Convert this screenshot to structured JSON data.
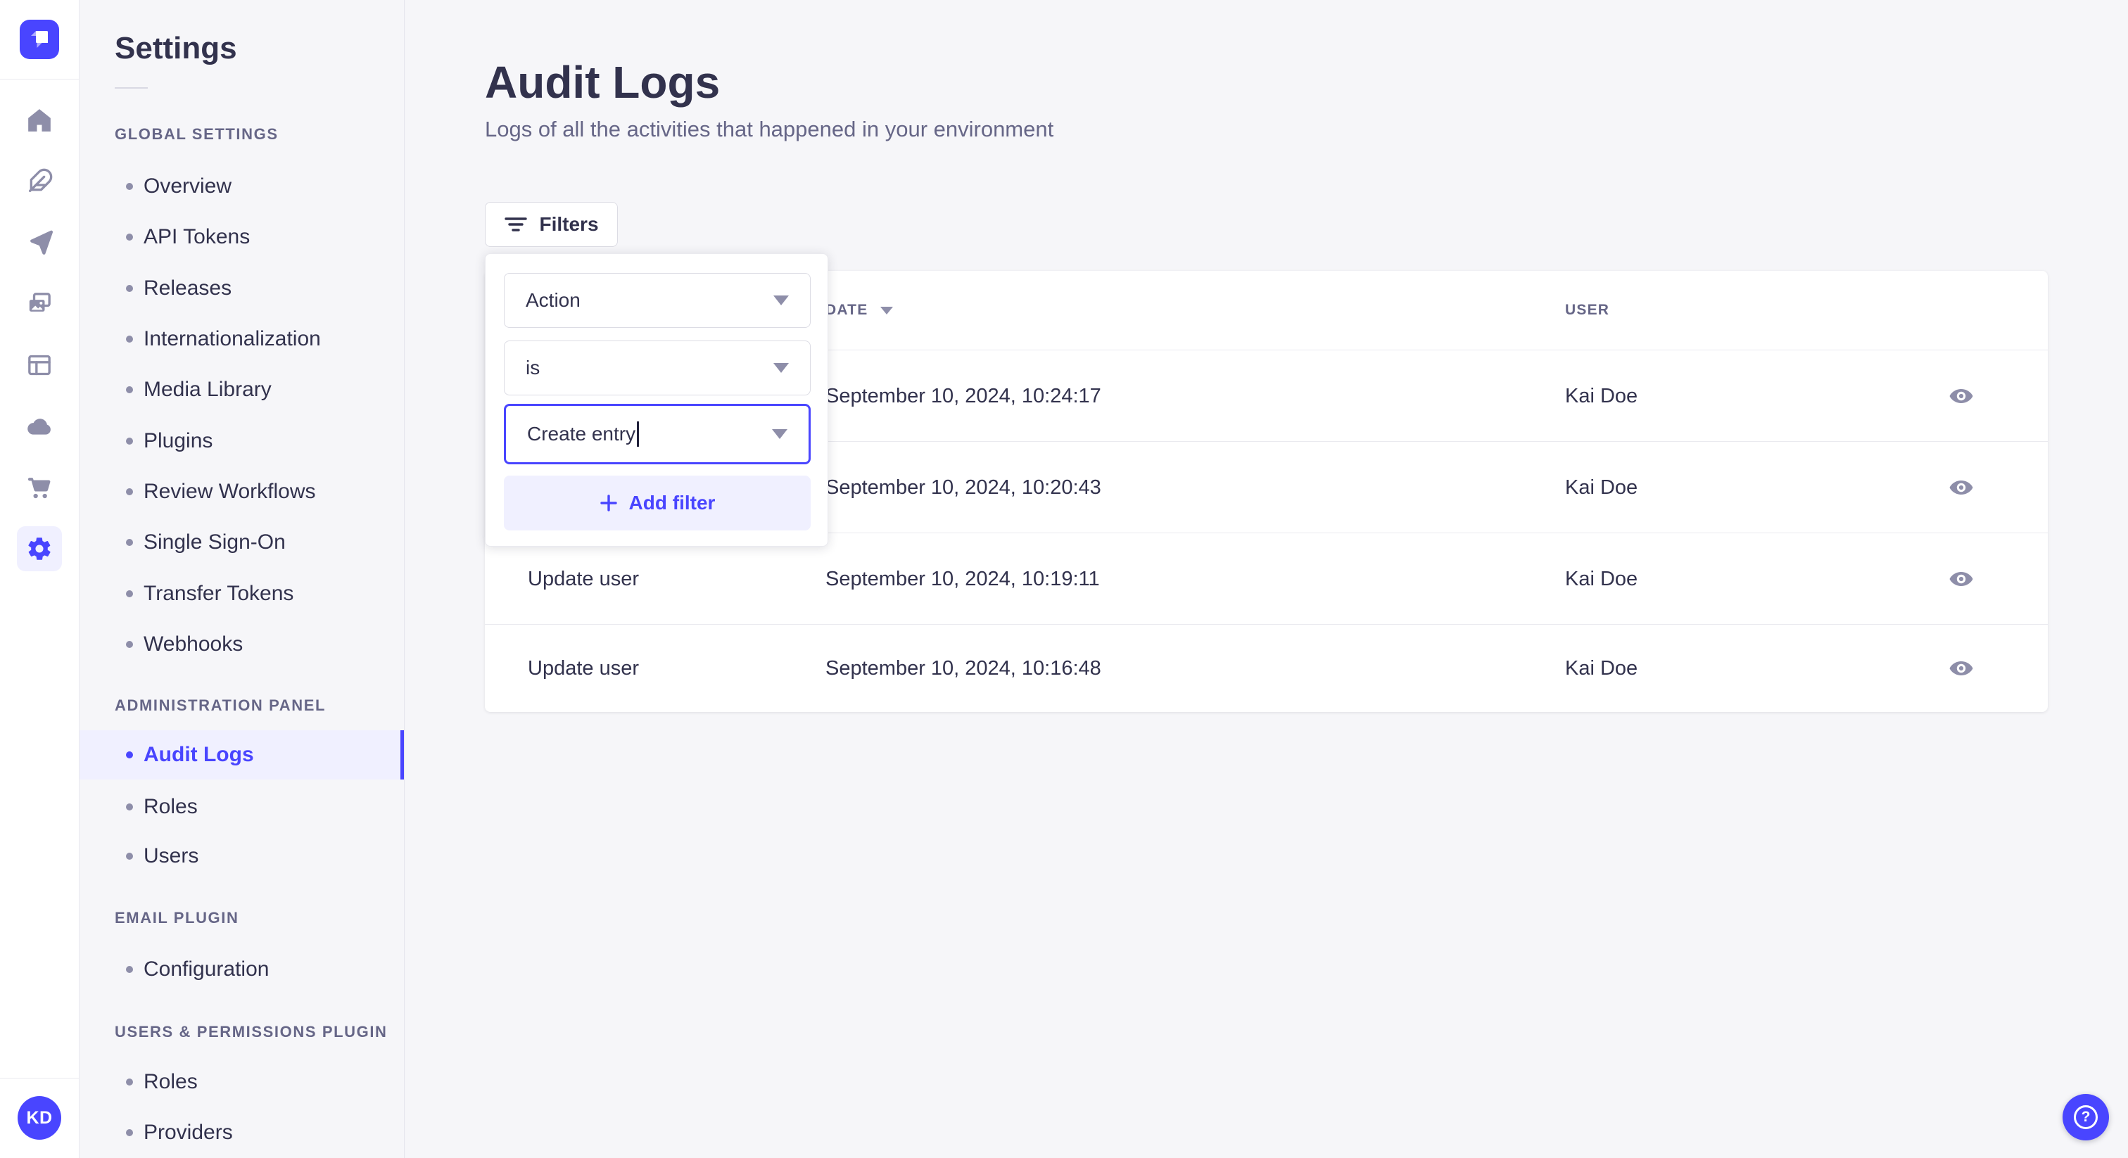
{
  "colors": {
    "accent": "#4945ff",
    "accent_bg": "#f0f0ff",
    "text_dark": "#32324d",
    "text_muted": "#666687",
    "icon_gray": "#8e8ea9",
    "page_bg": "#f6f6f9"
  },
  "icon_nav": {
    "logo_icon": "strapi-logo",
    "items": [
      {
        "icon": "home-icon"
      },
      {
        "icon": "feather-icon"
      },
      {
        "icon": "paper-plane-icon"
      },
      {
        "icon": "media-gallery-icon"
      },
      {
        "icon": "layout-icon"
      },
      {
        "icon": "cloud-icon"
      },
      {
        "icon": "cart-icon"
      },
      {
        "icon": "gear-icon",
        "active": true
      }
    ],
    "avatar_initials": "KD"
  },
  "subnav": {
    "title": "Settings",
    "sections": [
      {
        "label": "GLOBAL SETTINGS",
        "items": [
          {
            "label": "Overview"
          },
          {
            "label": "API Tokens"
          },
          {
            "label": "Releases"
          },
          {
            "label": "Internationalization"
          },
          {
            "label": "Media Library"
          },
          {
            "label": "Plugins"
          },
          {
            "label": "Review Workflows"
          },
          {
            "label": "Single Sign-On"
          },
          {
            "label": "Transfer Tokens"
          },
          {
            "label": "Webhooks"
          }
        ]
      },
      {
        "label": "ADMINISTRATION PANEL",
        "items": [
          {
            "label": "Audit Logs",
            "active": true
          },
          {
            "label": "Roles"
          },
          {
            "label": "Users"
          }
        ]
      },
      {
        "label": "EMAIL PLUGIN",
        "items": [
          {
            "label": "Configuration"
          }
        ]
      },
      {
        "label": "USERS & PERMISSIONS PLUGIN",
        "items": [
          {
            "label": "Roles"
          },
          {
            "label": "Providers"
          }
        ]
      }
    ]
  },
  "main": {
    "title": "Audit Logs",
    "subtitle": "Logs of all the activities that happened in your environment",
    "filters_button_label": "Filters",
    "filter_popover": {
      "field_value": "Action",
      "operator_value": "is",
      "action_value": "Create entry",
      "add_filter_label": "Add filter"
    },
    "table": {
      "date_header": "DATE",
      "user_header": "USER",
      "rows": [
        {
          "action": "",
          "date": "September 10, 2024, 10:24:17",
          "user": "Kai Doe"
        },
        {
          "action": "",
          "date": "September 10, 2024, 10:20:43",
          "user": "Kai Doe"
        },
        {
          "action": "Update user",
          "date": "September 10, 2024, 10:19:11",
          "user": "Kai Doe"
        },
        {
          "action": "Update user",
          "date": "September 10, 2024, 10:16:48",
          "user": "Kai Doe"
        }
      ]
    }
  },
  "help": {
    "glyph": "?"
  }
}
